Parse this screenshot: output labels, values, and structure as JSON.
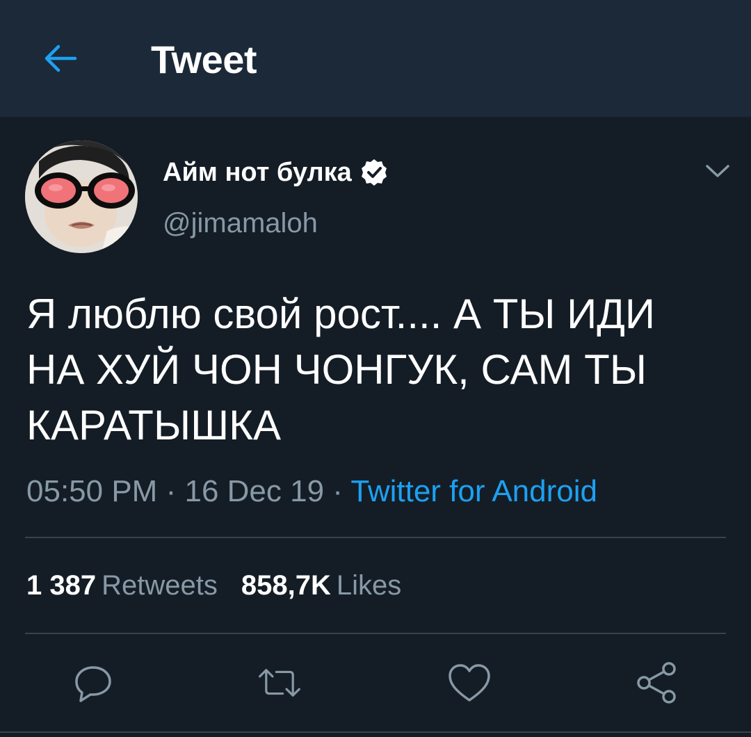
{
  "header": {
    "title": "Tweet",
    "back_icon": "arrow-left-icon",
    "accent_color": "#1da1f2"
  },
  "tweet": {
    "author": {
      "display_name": "Айм нот булка",
      "handle": "@jimamaloh",
      "verified": true
    },
    "text": "Я люблю свой рост.... А ТЫ ИДИ\nНА ХУЙ ЧОН ЧОНГУК, САМ ТЫ\nКАРАТЫШКА",
    "time": "05:50 PM",
    "date": "16 Dec 19",
    "separator": "·",
    "source": "Twitter for Android"
  },
  "stats": {
    "retweets_count": "1 387",
    "retweets_label": "Retweets",
    "likes_count": "858,7K",
    "likes_label": "Likes"
  },
  "actions": [
    "reply-icon",
    "retweet-icon",
    "like-icon",
    "share-icon"
  ],
  "colors": {
    "background": "#141d26",
    "header_background": "#1c2938",
    "secondary_text": "#8899a6",
    "divider": "#38444d"
  }
}
